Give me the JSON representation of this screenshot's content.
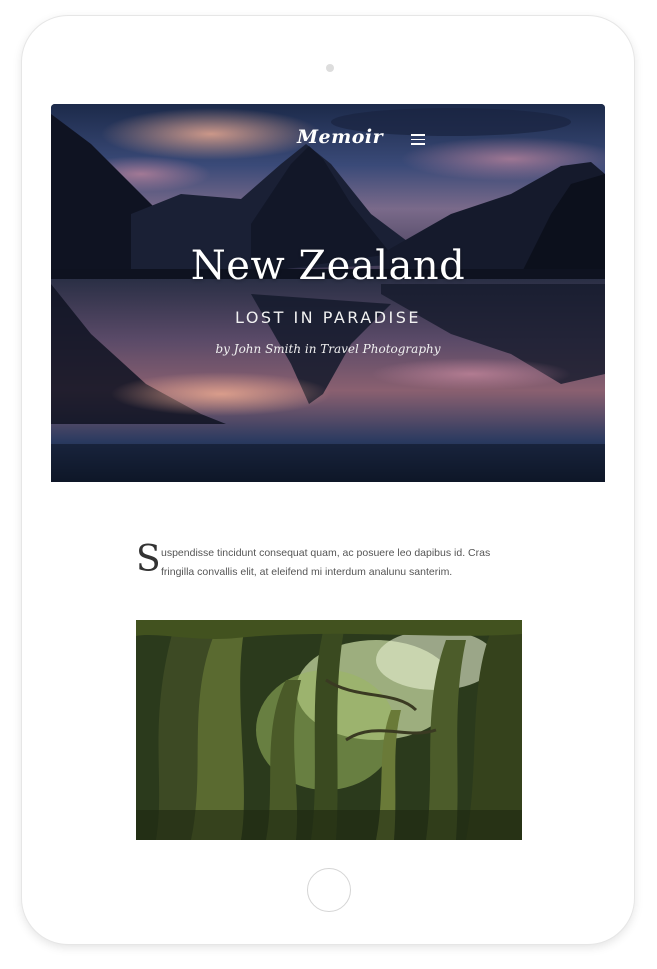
{
  "brand": {
    "logo": "Memoir"
  },
  "nav": {
    "menu_icon": "hamburger-menu-icon"
  },
  "hero": {
    "title": "New Zealand",
    "subtitle": "LOST IN PARADISE",
    "byline": "by John Smith in Travel Photography"
  },
  "article": {
    "dropcap": "S",
    "intro": "uspendisse tincidunt consequat quam, ac posuere leo dapibus id. Cras fringilla convallis elit, at eleifend mi interdum analunu santerim."
  },
  "device": {
    "frame_color": "#ffffff",
    "home_button_icon": "home-button"
  },
  "colors": {
    "hero_text": "#ffffff",
    "body_text": "#555555",
    "dropcap": "#333333"
  }
}
